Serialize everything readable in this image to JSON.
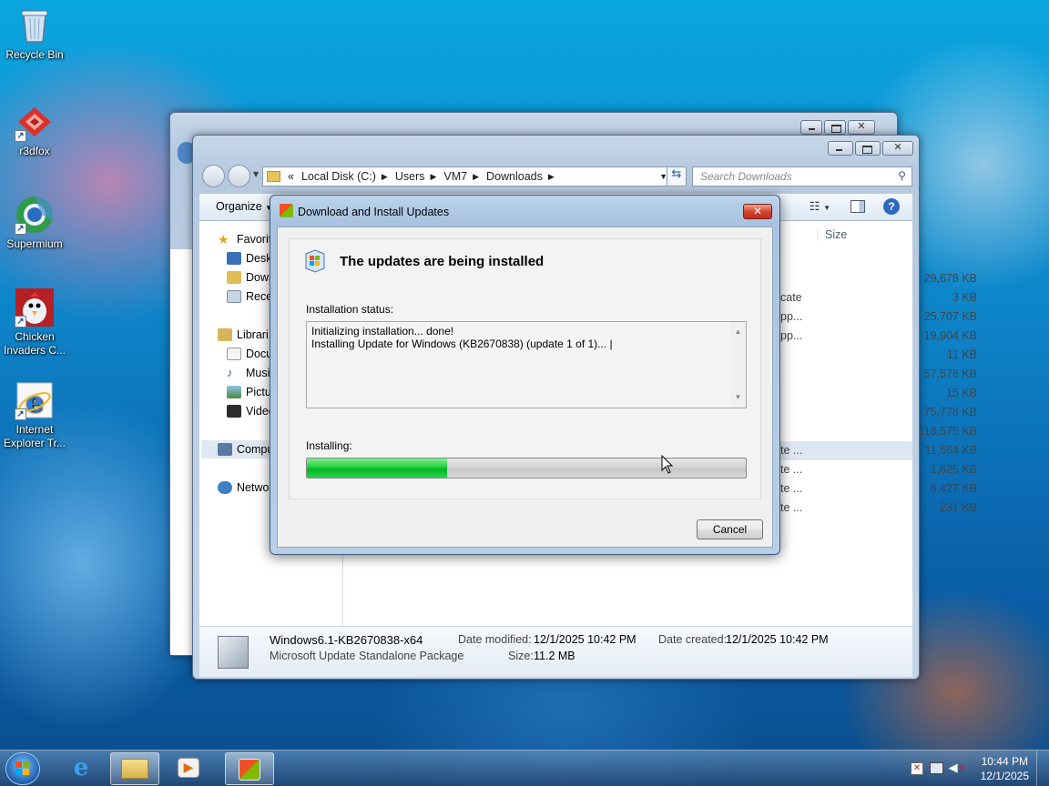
{
  "desktop": {
    "icons": [
      {
        "label": "Recycle Bin",
        "icon": "recycle-bin-icon"
      },
      {
        "label": "r3dfox",
        "icon": "r3dfox-icon"
      },
      {
        "label": "Supermium",
        "icon": "supermium-icon"
      },
      {
        "label": "Chicken Invaders C...",
        "icon": "chicken-invaders-icon"
      },
      {
        "label": "Internet Explorer Tr...",
        "icon": "internet-explorer-icon"
      }
    ]
  },
  "explorer": {
    "breadcrumb": {
      "overflow": "«",
      "parts": [
        "Local Disk (C:)",
        "Users",
        "VM7",
        "Downloads"
      ]
    },
    "search_placeholder": "Search Downloads",
    "toolbar": {
      "organize": "Organize"
    },
    "column_size": "Size",
    "nav": {
      "favorites": "Favorit",
      "desktop": "Desk",
      "downloads": "Down",
      "recent": "Rece",
      "libraries": "Librari",
      "documents": "Docu",
      "music": "Musi",
      "pictures": "Pictu",
      "videos": "Video",
      "computer": "Compu",
      "network": "Netwo"
    },
    "rows": [
      {
        "type": "",
        "size": "29,678 KB"
      },
      {
        "type": "cate",
        "size": "3 KB"
      },
      {
        "type": "pp...",
        "size": "25,707 KB"
      },
      {
        "type": "pp...",
        "size": "19,904 KB"
      },
      {
        "type": "",
        "size": "11 KB"
      },
      {
        "type": "",
        "size": "57,578 KB"
      },
      {
        "type": "",
        "size": "15 KB"
      },
      {
        "type": "",
        "size": "75,778 KB"
      },
      {
        "type": "",
        "size": "118,575 KB"
      },
      {
        "type": "te ...",
        "size": "11,564 KB",
        "selected": true
      },
      {
        "type": "te ...",
        "size": "1,625 KB"
      },
      {
        "type": "te ...",
        "size": "6,427 KB"
      },
      {
        "type": "te ...",
        "size": "231 KB"
      }
    ],
    "details": {
      "name": "Windows6.1-KB2670838-x64",
      "type": "Microsoft Update Standalone Package",
      "modified_label": "Date modified:",
      "modified_value": "12/1/2025 10:42 PM",
      "size_label": "Size:",
      "size_value": "11.2 MB",
      "created_label": "Date created:",
      "created_value": "12/1/2025 10:42 PM"
    }
  },
  "dialog": {
    "title": "Download and Install Updates",
    "heading": "The updates are being installed",
    "status_label": "Installation status:",
    "status_lines": [
      "Initializing installation... done!",
      "Installing Update for Windows (KB2670838) (update 1 of 1)... |"
    ],
    "progress_label": "Installing:",
    "progress_fraction": 0.32,
    "cancel": "Cancel"
  },
  "taskbar": {
    "time": "10:44 PM",
    "date": "12/1/2025"
  }
}
